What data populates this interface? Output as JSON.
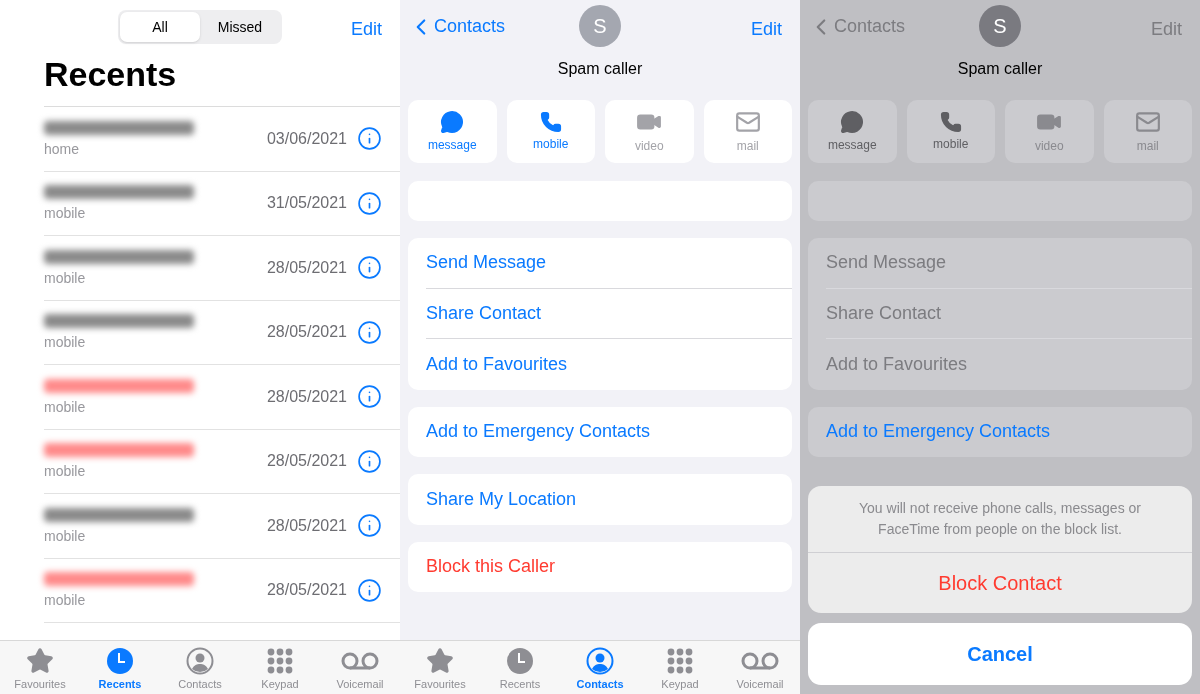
{
  "recents": {
    "segments": [
      {
        "label": "All",
        "selected": true
      },
      {
        "label": "Missed",
        "selected": false
      }
    ],
    "edit": "Edit",
    "title": "Recents",
    "calls": [
      {
        "missed": false,
        "type": "home",
        "date": "03/06/2021"
      },
      {
        "missed": false,
        "type": "mobile",
        "date": "31/05/2021"
      },
      {
        "missed": false,
        "type": "mobile",
        "date": "28/05/2021"
      },
      {
        "missed": false,
        "type": "mobile",
        "date": "28/05/2021"
      },
      {
        "missed": true,
        "type": "mobile",
        "date": "28/05/2021"
      },
      {
        "missed": true,
        "type": "mobile",
        "date": "28/05/2021"
      },
      {
        "missed": false,
        "type": "mobile",
        "date": "28/05/2021"
      },
      {
        "missed": true,
        "type": "mobile",
        "date": "28/05/2021"
      }
    ],
    "tabs": [
      {
        "label": "Favourites",
        "kind": "star",
        "selected": false
      },
      {
        "label": "Recents",
        "kind": "clock",
        "selected": true
      },
      {
        "label": "Contacts",
        "kind": "person",
        "selected": false
      },
      {
        "label": "Keypad",
        "kind": "keypad",
        "selected": false
      },
      {
        "label": "Voicemail",
        "kind": "voicemail",
        "selected": false
      }
    ]
  },
  "contact": {
    "back": "Contacts",
    "initial": "S",
    "edit": "Edit",
    "name": "Spam caller",
    "actions": [
      {
        "label": "message",
        "kind": "message",
        "disabled": false
      },
      {
        "label": "mobile",
        "kind": "phone",
        "disabled": false
      },
      {
        "label": "video",
        "kind": "video",
        "disabled": true
      },
      {
        "label": "mail",
        "kind": "mail",
        "disabled": true
      }
    ],
    "groups": [
      [
        {
          "label": "Send Message",
          "destructive": false
        },
        {
          "label": "Share Contact",
          "destructive": false
        },
        {
          "label": "Add to Favourites",
          "destructive": false
        }
      ],
      [
        {
          "label": "Add to Emergency Contacts",
          "destructive": false
        }
      ],
      [
        {
          "label": "Share My Location",
          "destructive": false
        }
      ],
      [
        {
          "label": "Block this Caller",
          "destructive": true
        }
      ]
    ],
    "tabs": [
      {
        "label": "Favourites",
        "kind": "star",
        "selected": false
      },
      {
        "label": "Recents",
        "kind": "clock",
        "selected": false
      },
      {
        "label": "Contacts",
        "kind": "person",
        "selected": true
      },
      {
        "label": "Keypad",
        "kind": "keypad",
        "selected": false
      },
      {
        "label": "Voicemail",
        "kind": "voicemail",
        "selected": false
      }
    ]
  },
  "blocking": {
    "back": "Contacts",
    "initial": "S",
    "edit": "Edit",
    "name": "Spam caller",
    "actions": [
      {
        "label": "message",
        "kind": "message",
        "disabled": false
      },
      {
        "label": "mobile",
        "kind": "phone",
        "disabled": false
      },
      {
        "label": "video",
        "kind": "video",
        "disabled": true
      },
      {
        "label": "mail",
        "kind": "mail",
        "disabled": true
      }
    ],
    "groups": [
      [
        {
          "label": "Send Message",
          "destructive": false
        },
        {
          "label": "Share Contact",
          "destructive": false
        },
        {
          "label": "Add to Favourites",
          "destructive": false
        }
      ],
      [
        {
          "label": "Add to Emergency Contacts",
          "destructive": false
        }
      ]
    ],
    "sheet": {
      "message": "You will not receive phone calls, messages or FaceTime from people on the block list.",
      "confirm": "Block Contact",
      "cancel": "Cancel"
    }
  }
}
